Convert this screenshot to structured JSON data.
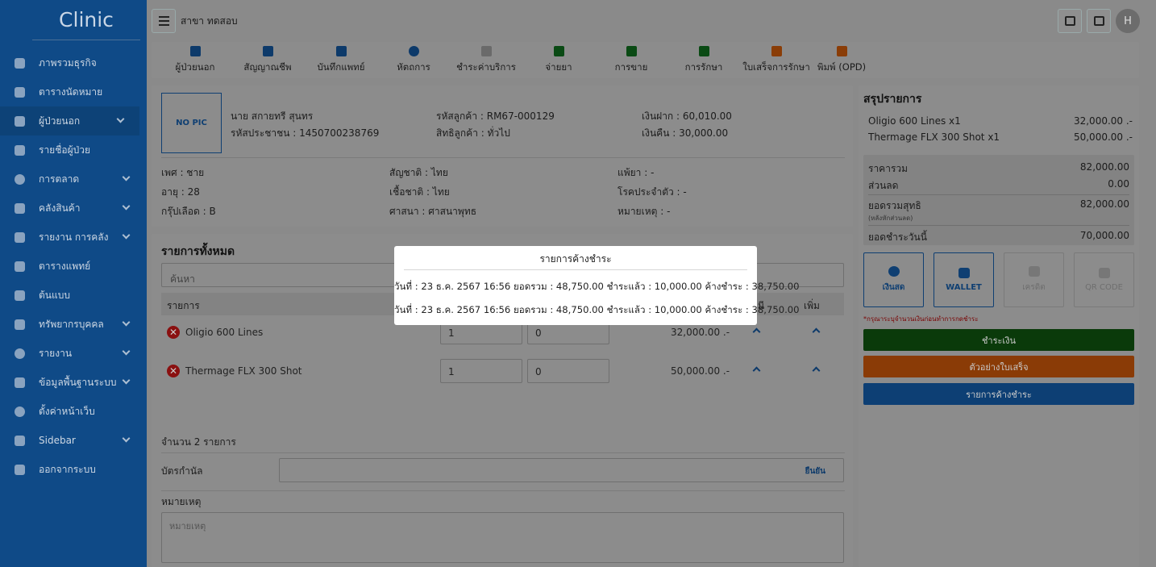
{
  "sidebar": {
    "brand": "Clinic",
    "items": [
      {
        "label": "ภาพรวมธุรกิจ",
        "icon": "dashboard-icon",
        "expand": false
      },
      {
        "label": "ตารางนัดหมาย",
        "icon": "calendar-icon",
        "expand": false
      },
      {
        "label": "ผู้ป่วยนอก",
        "icon": "shield-icon",
        "expand": true
      },
      {
        "label": "รายชื่อผู้ป่วย",
        "icon": "patients-icon",
        "expand": false
      },
      {
        "label": "การตลาด",
        "icon": "dollar-icon",
        "expand": true
      },
      {
        "label": "คลังสินค้า",
        "icon": "archive-icon",
        "expand": true
      },
      {
        "label": "รายงาน การคลัง",
        "icon": "clipboard-icon",
        "expand": true
      },
      {
        "label": "ตารางแพทย์",
        "icon": "doctor-schedule-icon",
        "expand": false
      },
      {
        "label": "ต้นแบบ",
        "icon": "shapes-icon",
        "expand": false
      },
      {
        "label": "ทรัพยากรบุคคล",
        "icon": "users-icon",
        "expand": true
      },
      {
        "label": "รายงาน",
        "icon": "alert-icon",
        "expand": true
      },
      {
        "label": "ข้อมูลพื้นฐานระบบ",
        "icon": "grid-icon",
        "expand": true
      },
      {
        "label": "ตั้งค่าหน้าเว็บ",
        "icon": "gear-icon",
        "expand": false
      },
      {
        "label": "Sidebar",
        "icon": "sidebar-icon",
        "expand": true
      },
      {
        "label": "ออกจากระบบ",
        "icon": "logout-icon",
        "expand": false
      }
    ]
  },
  "topbar": {
    "branch": "สาขา ทดสอบ",
    "avatar": "H"
  },
  "toolbar": {
    "items": [
      {
        "label": "ผู้ป่วยนอก",
        "color": "#0d3a6a"
      },
      {
        "label": "สัญญาณชีพ",
        "color": "#0d3a6a"
      },
      {
        "label": "บันทึกแพทย์",
        "color": "#0d3a6a"
      },
      {
        "label": "หัตถการ",
        "color": "#0d3a6a"
      },
      {
        "label": "ชำระค่าบริการ",
        "color": "#6a6a6a"
      },
      {
        "label": "จ่ายยา",
        "color": "#0a4a14"
      },
      {
        "label": "การขาย",
        "color": "#0a4a14"
      },
      {
        "label": "การรักษา",
        "color": "#0a4a14"
      },
      {
        "label": "ใบเสร็จการรักษา",
        "color": "#8a3d07"
      },
      {
        "label": "พิมพ์ (OPD)",
        "color": "#8a3d07"
      }
    ]
  },
  "patient": {
    "nopic": "NO PIC",
    "name": "นาย สกายทรี สุนทร",
    "id_card": "รหัสประชาชน : 1450700238769",
    "customer_code": "รหัสลูกค้า : RM67-000129",
    "customer_right": "สิทธิลูกค้า : ทั่วไป",
    "deposit": "เงินฝาก : 60,010.00",
    "refund": "เงินคืน : 30,000.00",
    "gender": "เพศ : ชาย",
    "age": "อายุ : 28",
    "blood": "กรุ๊ปเลือด : B",
    "nationality": "สัญชาติ : ไทย",
    "race": "เชื้อชาติ : ไทย",
    "religion": "ศาสนา : ศาสนาพุทธ",
    "allergy": "แพ้ยา : -",
    "disease": "โรคประจำตัว : -",
    "remark": "หมายเหตุ : -"
  },
  "items_section": {
    "title": "รายการทั้งหมด",
    "search_placeholder": "ค้นหา",
    "col_item": "รายการ",
    "col_partial": "นี",
    "col_add": "เพิ่ม",
    "rows": [
      {
        "name": "Oligio 600 Lines",
        "qty": "1",
        "discount": "0",
        "price": "32,000.00 .-"
      },
      {
        "name": "Thermage FLX 300 Shot",
        "qty": "1",
        "discount": "0",
        "price": "50,000.00 .-"
      }
    ],
    "count": "จำนวน 2 รายการ",
    "card_label": "บัตรกำนัล",
    "confirm": "ยืนยัน",
    "note_label": "หมายเหตุ",
    "note_placeholder": "หมายเหตุ"
  },
  "summary": {
    "title": "สรุปรายการ",
    "lines": [
      {
        "name": "Oligio 600 Lines x1",
        "value": "32,000.00 .-"
      },
      {
        "name": "Thermage FLX 300 Shot x1",
        "value": "50,000.00 .-"
      }
    ],
    "total_label": "ราคารวม",
    "total": "82,000.00",
    "discount_label": "ส่วนลด",
    "discount": "0.00",
    "net_label": "ยอดรวมสุทธิ",
    "net_sub": "(หลังหักส่วนลด)",
    "net": "82,000.00",
    "today_label": "ยอดชำระวันนี้",
    "today": "70,000.00",
    "pay_cash": "เงินสด",
    "pay_wallet": "WALLET",
    "pay_credit": "เครดิต",
    "pay_qr": "QR CODE",
    "note": "*กรุณาระบุจำนวนเงินก่อนทำการกดชำระ",
    "btn_pay": "ชำระเงิน",
    "btn_receipt": "ตัวอย่างใบเสร็จ",
    "btn_outstanding": "รายการค้างชำระ",
    "colors": {
      "pay": "#0a3a0a",
      "receipt": "#8a3b06",
      "outstanding": "#0d3f74"
    }
  },
  "modal": {
    "title": "รายการค้างชำระ",
    "lines": [
      "วันที่ : 23 ธ.ค. 2567 16:56 ยอดรวม : 48,750.00 ชำระแล้ว : 10,000.00 ค้างชำระ : 38,750.00",
      "วันที่ : 23 ธ.ค. 2567 16:56 ยอดรวม : 48,750.00 ชำระแล้ว : 10,000.00 ค้างชำระ : 38,750.00"
    ]
  }
}
